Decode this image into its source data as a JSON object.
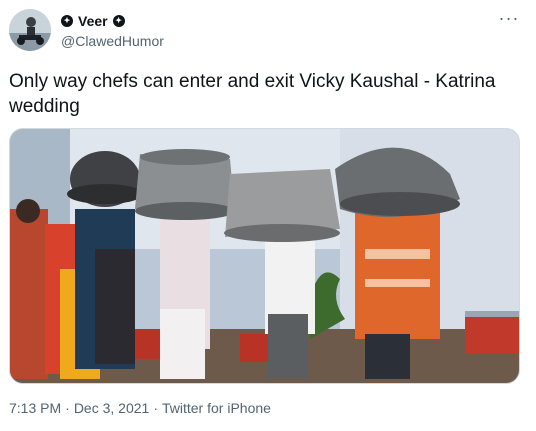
{
  "user": {
    "display_name": "Veer",
    "handle": "@ClawedHumor",
    "avatar_icon": "avatar-photo",
    "badge_icon": "circle-star-icon"
  },
  "tweet": {
    "text": "Only way chefs can enter and exit Vicky Kaushal - Katrina wedding",
    "time": "7:13 PM",
    "date": "Dec 3, 2021",
    "source": "Twitter for iPhone",
    "separator": "·"
  },
  "menu": {
    "more_icon": "more-horizontal-icon",
    "more_glyph": "···"
  },
  "colors": {
    "text": "#0f1419",
    "secondary": "#536471",
    "border": "#cfd9de"
  }
}
